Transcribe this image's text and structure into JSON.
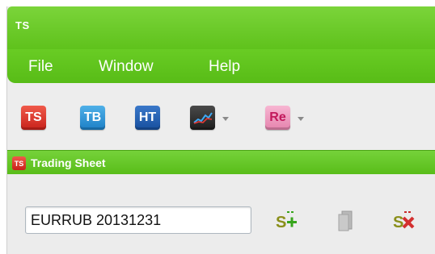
{
  "app": {
    "title": "TS"
  },
  "menu": {
    "items": [
      "File",
      "Window",
      "Help"
    ]
  },
  "toolbar": {
    "buttons": [
      {
        "label": "TS",
        "icon": "trading-sheet-icon",
        "color": "#d8372c"
      },
      {
        "label": "TB",
        "icon": "trading-book-icon",
        "color": "#2f93d6"
      },
      {
        "label": "HT",
        "icon": "history-table-icon",
        "color": "#255fb3"
      },
      {
        "label": "",
        "icon": "chart-icon",
        "color": "#2b2b2b",
        "has_dropdown": true
      },
      {
        "label": "Re",
        "icon": "report-icon",
        "color": "#ee9cc0",
        "has_dropdown": true
      }
    ]
  },
  "sheet": {
    "icon_label": "TS",
    "title": "Trading Sheet",
    "symbol_value": "EURRUB 20131231",
    "actions": [
      {
        "icon": "add-symbol-icon",
        "label": "S+"
      },
      {
        "icon": "copy-icon",
        "label": ""
      },
      {
        "icon": "delete-symbol-icon",
        "label": "S×"
      }
    ]
  },
  "colors": {
    "accent": "#5fc21c",
    "background": "#ededed"
  }
}
